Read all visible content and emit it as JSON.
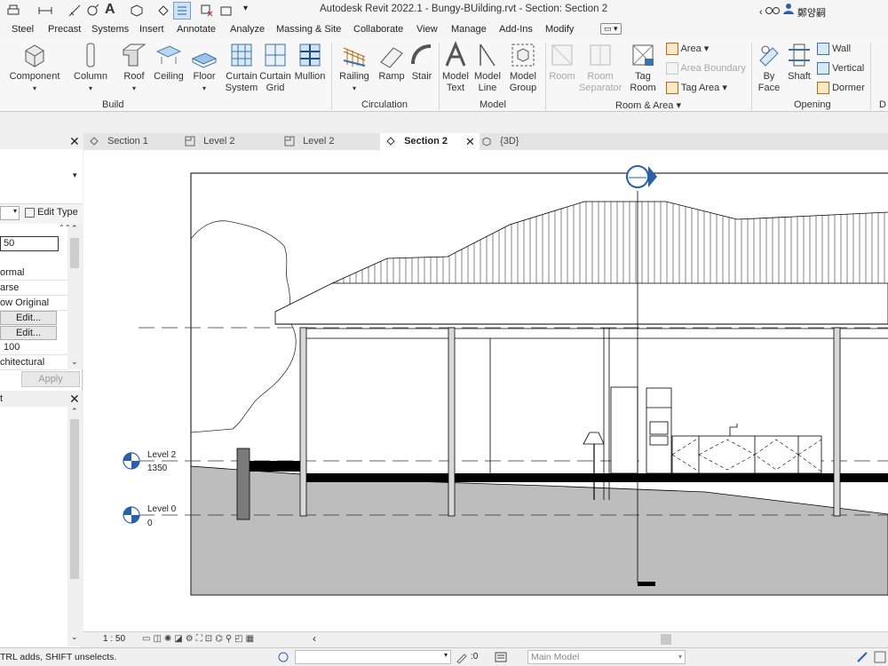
{
  "titlebar": {
    "title": "Autodesk Revit 2022.1 - Bungy-BUilding.rvt - Section: Section 2",
    "user": "鄭양嗣",
    "letter_a": "A"
  },
  "ribbon_tabs": [
    "Steel",
    "Precast",
    "Systems",
    "Insert",
    "Annotate",
    "Analyze",
    "Massing & Site",
    "Collaborate",
    "View",
    "Manage",
    "Add-Ins",
    "Modify"
  ],
  "ribbon": {
    "build": {
      "label": "Build",
      "buttons": [
        {
          "l1": "Component",
          "l2": ""
        },
        {
          "l1": "Column",
          "l2": ""
        },
        {
          "l1": "Roof",
          "l2": ""
        },
        {
          "l1": "Ceiling",
          "l2": ""
        },
        {
          "l1": "Floor",
          "l2": ""
        },
        {
          "l1": "Curtain",
          "l2": "System"
        },
        {
          "l1": "Curtain",
          "l2": "Grid"
        },
        {
          "l1": "Mullion",
          "l2": ""
        }
      ]
    },
    "circulation": {
      "label": "Circulation",
      "buttons": [
        {
          "l1": "Railing"
        },
        {
          "l1": "Ramp"
        },
        {
          "l1": "Stair"
        }
      ]
    },
    "model": {
      "label": "Model",
      "buttons": [
        {
          "l1": "Model",
          "l2": "Text"
        },
        {
          "l1": "Model",
          "l2": "Line"
        },
        {
          "l1": "Model",
          "l2": "Group"
        }
      ]
    },
    "room_area": {
      "label": "Room & Area",
      "buttons": [
        {
          "l1": "Room",
          "l2": ""
        },
        {
          "l1": "Room",
          "l2": "Separator"
        },
        {
          "l1": "Tag",
          "l2": "Room"
        }
      ],
      "small": [
        "Area",
        "Area  Boundary",
        "Tag  Area"
      ]
    },
    "opening": {
      "label": "Opening",
      "buttons": [
        {
          "l1": "By",
          "l2": "Face"
        },
        {
          "l1": "Shaft",
          "l2": ""
        }
      ],
      "small": [
        "Wall",
        "Vertical",
        "Dormer"
      ],
      "next_label": "D"
    }
  },
  "properties": {
    "edit_type": "Edit Type",
    "scale_value": "50",
    "rows": [
      "ormal",
      "arse",
      "ow Original"
    ],
    "edit_btn": "Edit...",
    "row_100": "100",
    "row_arch": "chitectural",
    "apply": "Apply"
  },
  "browser": {
    "title_frag": "t"
  },
  "view_tabs": [
    {
      "label": "Section 1",
      "active": false
    },
    {
      "label": "Level 2",
      "active": false
    },
    {
      "label": "Level 2",
      "active": false
    },
    {
      "label": "Section 2",
      "active": true
    },
    {
      "label": "{3D}",
      "active": false
    }
  ],
  "levels": [
    {
      "name": "Level 2",
      "elevation": "1350"
    },
    {
      "name": "Level 0",
      "elevation": "0"
    }
  ],
  "view_control": {
    "scale": "1 : 50"
  },
  "status": {
    "message": "TRL adds, SHIFT unselects.",
    "count": ":0",
    "model": "Main Model"
  }
}
